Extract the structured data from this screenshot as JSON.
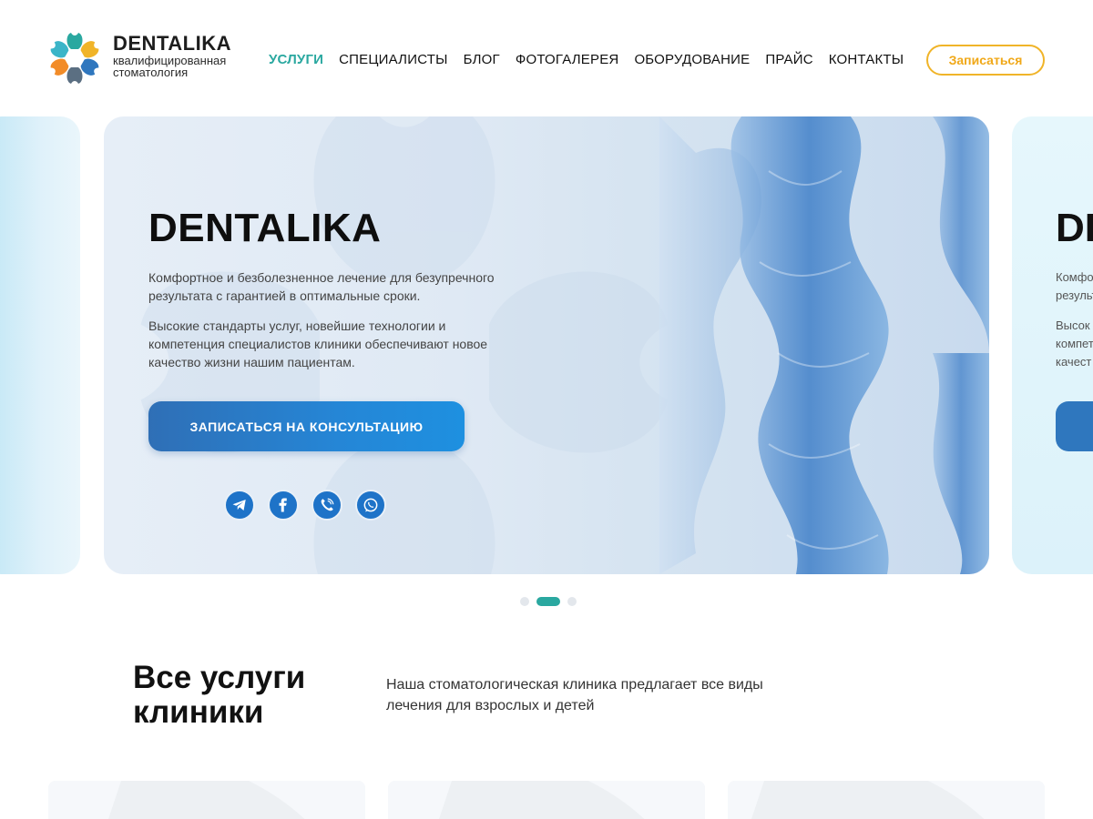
{
  "header": {
    "brand": "DENTALIKA",
    "tagline_line1": "квалифицированная",
    "tagline_line2": "стоматология",
    "nav": [
      {
        "label": "Услуги",
        "active": true
      },
      {
        "label": "Специалисты",
        "active": false
      },
      {
        "label": "Блог",
        "active": false
      },
      {
        "label": "Фотогалерея",
        "active": false
      },
      {
        "label": "Оборудование",
        "active": false
      },
      {
        "label": "Прайс",
        "active": false
      },
      {
        "label": "Контакты",
        "active": false
      }
    ],
    "cta_label": "Записаться"
  },
  "hero": {
    "title": "DENTALIKA",
    "paragraph1": "Комфортное и безболезненное лечение для безупречного результата с гарантией в оптимальные сроки.",
    "paragraph2": "Высокие стандарты услуг, новейшие технологии и компетенция специалистов клиники обеспечивают новое качество жизни нашим пациентам.",
    "button_label": "ЗАПИСАТЬСЯ НА КОНСУЛЬТАЦИЮ",
    "socials": [
      "telegram-icon",
      "facebook-icon",
      "viber-icon",
      "whatsapp-icon"
    ],
    "next_slide_title": "DE",
    "next_slide_lines": [
      "Комфорт",
      "результ",
      "Высок",
      "компет",
      "качест"
    ],
    "dots_total": 3,
    "dots_active": 1
  },
  "services": {
    "title": "Все услуги клиники",
    "description": "Наша стоматологическая клиника предлагает все виды лечения для взрослых и детей"
  },
  "colors": {
    "accent_teal": "#2aa8a0",
    "accent_orange": "#f0b429",
    "primary_blue": "#2f77be"
  }
}
